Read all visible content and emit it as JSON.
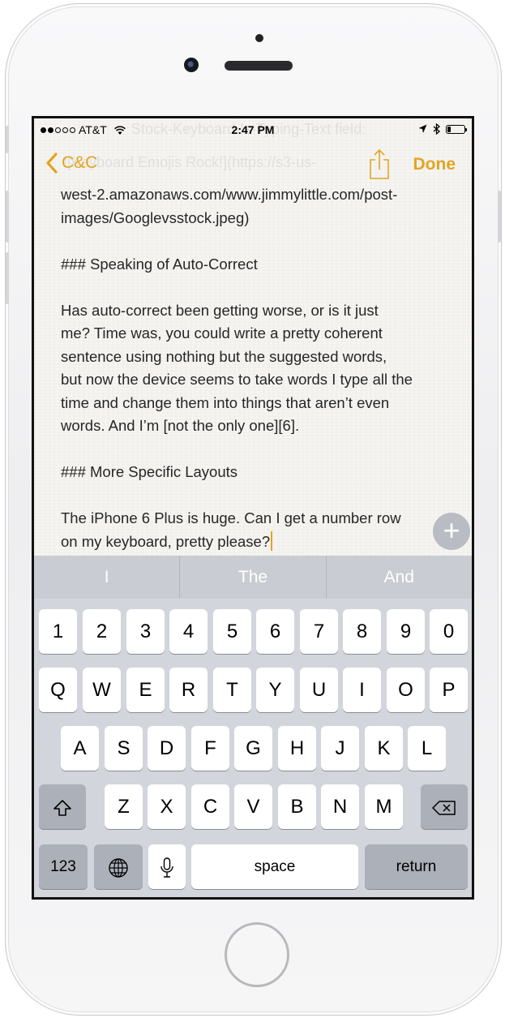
{
  "status_bar": {
    "carrier": "AT&T",
    "time": "2:47 PM",
    "signal_bars_filled": 2,
    "signal_bars_total": 5
  },
  "nav": {
    "back_label": "C&C",
    "done_label": "Done",
    "accent_color": "#e3a520"
  },
  "ghost_text": {
    "line1": "Stock-Keyboard-Is-Typing-Text field:",
    "line2": "![Keyboard Emojis Rock!](https://s3-us-"
  },
  "note": {
    "lines": {
      "l1": "west-2.amazonaws.com/www.jimmylittle.com/post-",
      "l2": "images/Googlevsstock.jpeg)",
      "l3": "### Speaking of Auto-Correct",
      "l4": "Has auto-correct been getting worse, or is it just",
      "l5": "me?  Time was, you could write a pretty coherent",
      "l6": "sentence using nothing but the suggested words,",
      "l7": "but now the device seems to take words I type all the",
      "l8": "time and change them into things that aren’t even",
      "l9": "words.  And I’m [not the only one][6].",
      "l10": "### More Specific Layouts",
      "l11": "The iPhone 6 Plus is huge.  Can I get a number row",
      "l12": "on my keyboard, pretty please?"
    }
  },
  "add_button": {
    "icon": "plus-icon",
    "label": "+"
  },
  "keyboard": {
    "suggestions": [
      "I",
      "The",
      "And"
    ],
    "numbers": [
      "1",
      "2",
      "3",
      "4",
      "5",
      "6",
      "7",
      "8",
      "9",
      "0"
    ],
    "row1": [
      "Q",
      "W",
      "E",
      "R",
      "T",
      "Y",
      "U",
      "I",
      "O",
      "P"
    ],
    "row2": [
      "A",
      "S",
      "D",
      "F",
      "G",
      "H",
      "J",
      "K",
      "L"
    ],
    "row3": [
      "Z",
      "X",
      "C",
      "V",
      "B",
      "N",
      "M"
    ],
    "shift_icon": "shift-icon",
    "delete_icon": "delete-icon",
    "numbers_key": "123",
    "globe_icon": "globe-icon",
    "mic_icon": "microphone-icon",
    "space_label": "space",
    "return_label": "return"
  }
}
